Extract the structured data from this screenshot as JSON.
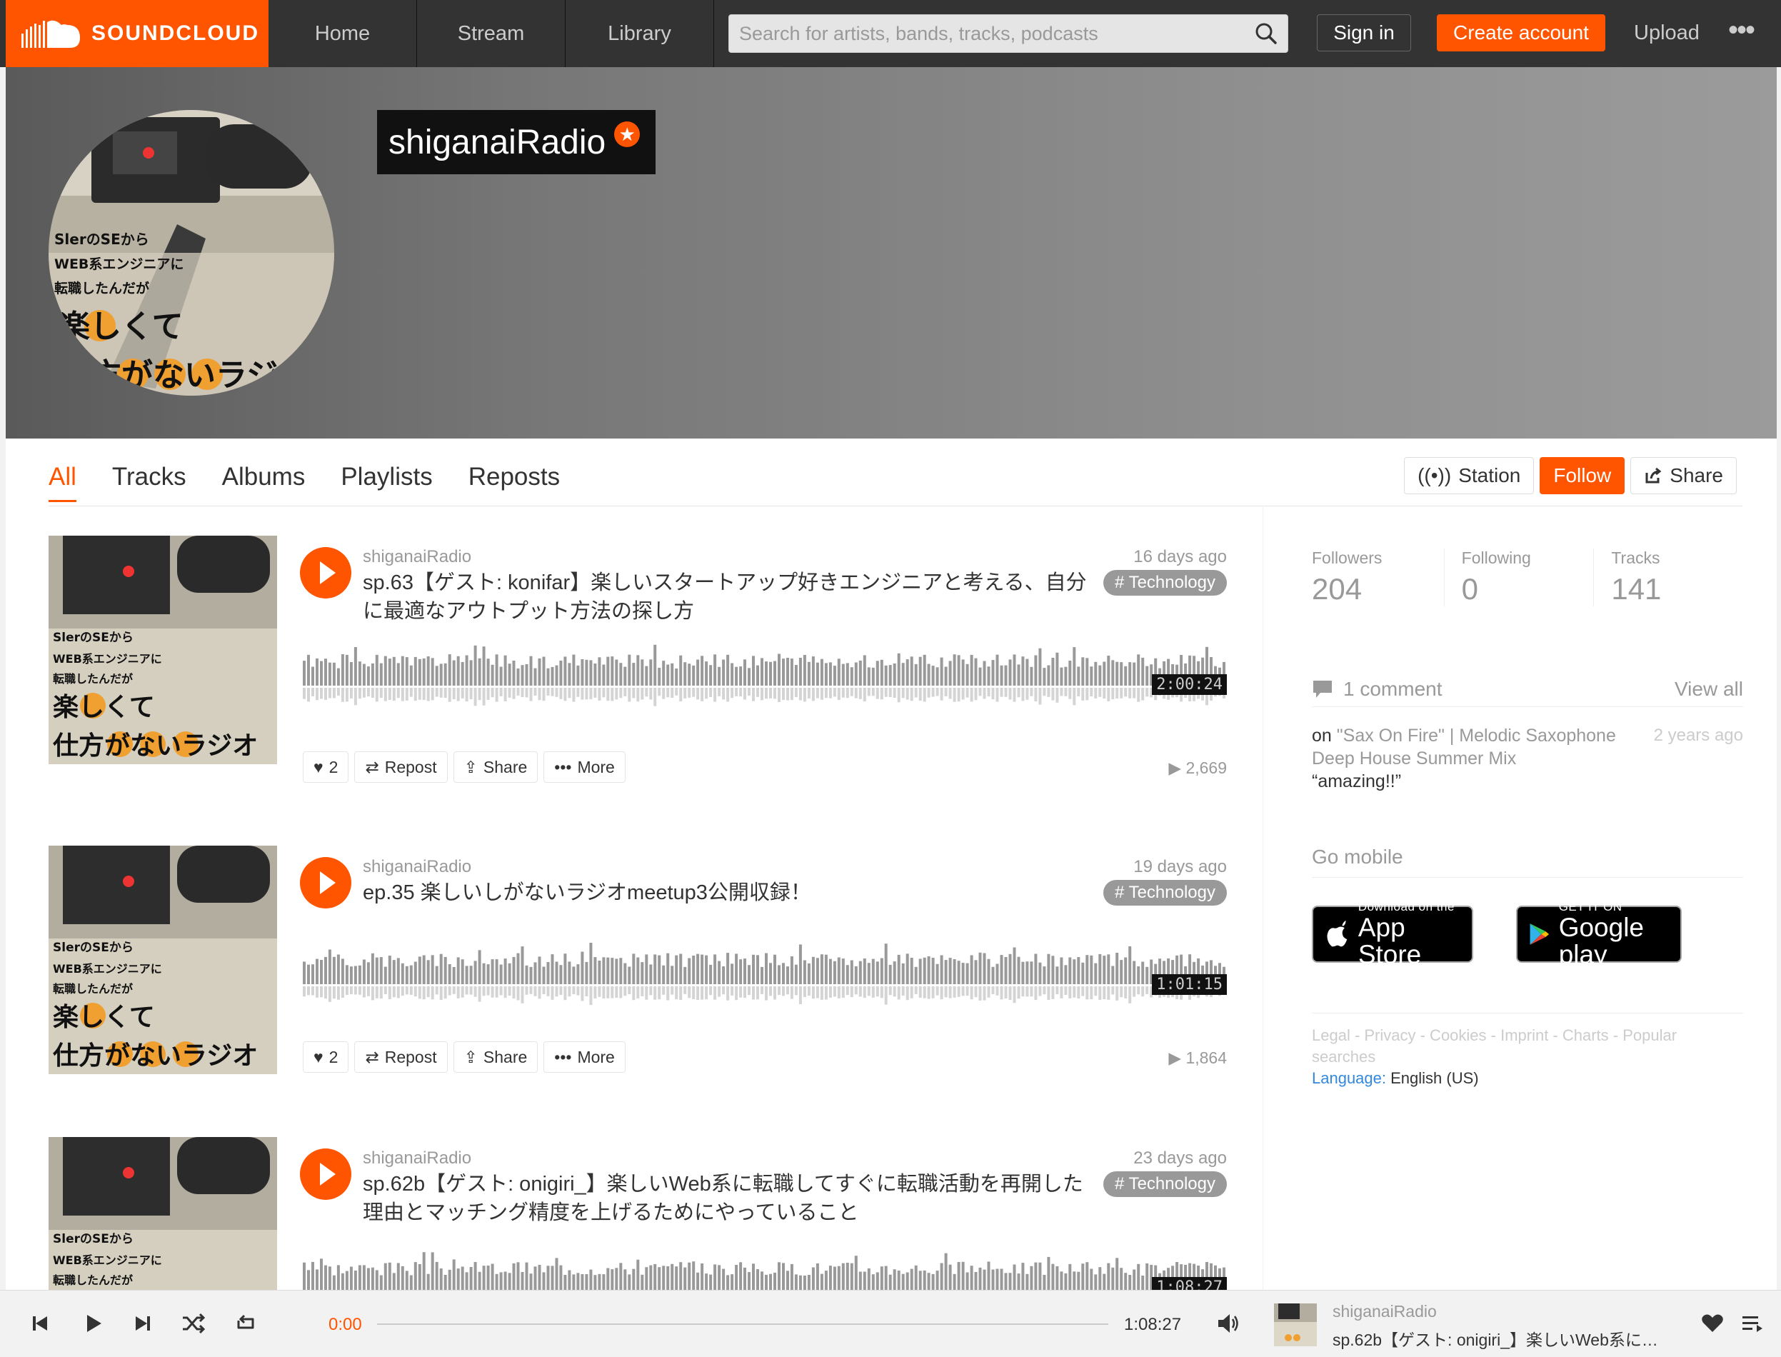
{
  "header": {
    "logo_text": "SOUNDCLOUD",
    "nav": [
      "Home",
      "Stream",
      "Library"
    ],
    "search_placeholder": "Search for artists, bands, tracks, podcasts",
    "sign_in": "Sign in",
    "create_account": "Create account",
    "upload": "Upload",
    "more": "•••"
  },
  "profile": {
    "username": "shiganaiRadio",
    "pro_badge": "★",
    "artwork_lines": [
      "SlerのSEから",
      "WEB系エンジニアに",
      "転職したんだが",
      "楽しくて",
      "仕方がないラジオ"
    ]
  },
  "tabs": [
    "All",
    "Tracks",
    "Albums",
    "Playlists",
    "Reposts"
  ],
  "actions": {
    "station": "Station",
    "follow": "Follow",
    "share": "Share"
  },
  "tracks": [
    {
      "user": "shiganaiRadio",
      "title": "sp.63【ゲスト: konifar】楽しいスタートアップ好きエンジニアと考える、自分に最適なアウトプット方法の探し方",
      "date": "16 days ago",
      "tag": "# Technology",
      "duration": "2:00:24",
      "likes": "2",
      "repost": "Repost",
      "share": "Share",
      "more": "More",
      "plays": "2,669"
    },
    {
      "user": "shiganaiRadio",
      "title": "ep.35 楽しいしがないラジオmeetup3公開収録！",
      "date": "19 days ago",
      "tag": "# Technology",
      "duration": "1:01:15",
      "likes": "2",
      "repost": "Repost",
      "share": "Share",
      "more": "More",
      "plays": "1,864"
    },
    {
      "user": "shiganaiRadio",
      "title": "sp.62b【ゲスト: onigiri_】楽しいWeb系に転職してすぐに転職活動を再開した理由とマッチング精度を上げるためにやっていること",
      "date": "23 days ago",
      "tag": "# Technology",
      "duration": "1:08:27"
    }
  ],
  "stats": [
    {
      "label": "Followers",
      "value": "204"
    },
    {
      "label": "Following",
      "value": "0"
    },
    {
      "label": "Tracks",
      "value": "141"
    }
  ],
  "comments": {
    "count": "1 comment",
    "view_all": "View all",
    "on": "on",
    "track": "\"Sax On Fire\" | Melodic Saxophone Deep House Summer Mix",
    "ago": "2 years ago",
    "text": "“amazing!!”"
  },
  "mobile": {
    "heading": "Go mobile",
    "appstore_small": "Download on the",
    "appstore_big": "App Store",
    "googleplay_small": "GET IT ON",
    "googleplay_big": "Google play"
  },
  "footer": {
    "links": "Legal ‑ Privacy ‑ Cookies ‑ Imprint ‑ Charts ‑ Popular searches",
    "language_label": "Language:",
    "language_value": " English (US)"
  },
  "player": {
    "elapsed": "0:00",
    "total": "1:08:27",
    "progress": 0,
    "user": "shiganaiRadio",
    "title": "sp.62b【ゲスト: onigiri_】楽しいWeb系に転職..."
  },
  "colors": {
    "accent": "#ff5500",
    "header_bg": "#333333",
    "tag_bg": "#999999"
  }
}
